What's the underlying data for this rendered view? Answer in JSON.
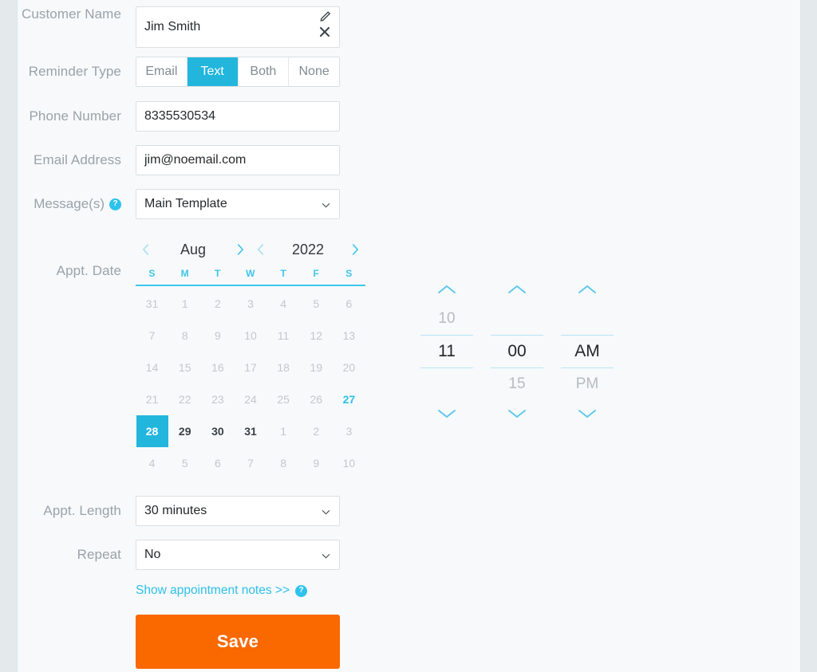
{
  "theme": {
    "accent": "#22b6dd",
    "accent_light": "#2ec0ea",
    "save_orange": "#fa6800",
    "label_gray": "#9aa3ab",
    "page_bg": "#f7f9fa",
    "gutter_bg": "#e4e9ec"
  },
  "form": {
    "customer_name": {
      "label": "Customer Name",
      "value": "Jim Smith",
      "placeholder": "Customer Name",
      "edit_icon": "pencil-icon",
      "clear_icon": "close-icon"
    },
    "reminder_type": {
      "label": "Reminder Type",
      "options": [
        "Email",
        "Text",
        "Both",
        "None"
      ],
      "selected": "Text"
    },
    "phone_number": {
      "label": "Phone Number",
      "value": "8335530534",
      "placeholder": "Phone Number"
    },
    "email_address": {
      "label": "Email Address",
      "value": "jim@noemail.com",
      "placeholder": "Email Address"
    },
    "messages": {
      "label": "Message(s)",
      "help_icon": "help-circle-icon",
      "value": "Main Template",
      "options": [
        "Main Template"
      ]
    },
    "appt_date": {
      "label": "Appt. Date"
    },
    "appt_length": {
      "label": "Appt. Length",
      "value": "30 minutes",
      "options": [
        "30 minutes"
      ]
    },
    "repeat": {
      "label": "Repeat",
      "value": "No",
      "options": [
        "No"
      ]
    },
    "notes_link": {
      "text": "Show appointment notes >>",
      "help_icon": "help-circle-icon"
    },
    "save_button": {
      "label": "Save"
    }
  },
  "calendar": {
    "month": "Aug",
    "year": "2022",
    "prev_month_icon": "chevron-left-icon",
    "next_month_icon": "chevron-right-icon",
    "prev_year_icon": "chevron-left-icon",
    "next_year_icon": "chevron-right-icon",
    "dow": [
      "S",
      "M",
      "T",
      "W",
      "T",
      "F",
      "S"
    ],
    "selected_day": 28,
    "today": 27,
    "weeks": [
      [
        {
          "d": "31",
          "state": "other"
        },
        {
          "d": "1",
          "state": "other"
        },
        {
          "d": "2",
          "state": "other"
        },
        {
          "d": "3",
          "state": "other"
        },
        {
          "d": "4",
          "state": "other"
        },
        {
          "d": "5",
          "state": "other"
        },
        {
          "d": "6",
          "state": "other"
        }
      ],
      [
        {
          "d": "7",
          "state": "other"
        },
        {
          "d": "8",
          "state": "other"
        },
        {
          "d": "9",
          "state": "other"
        },
        {
          "d": "10",
          "state": "other"
        },
        {
          "d": "11",
          "state": "other"
        },
        {
          "d": "12",
          "state": "other"
        },
        {
          "d": "13",
          "state": "other"
        }
      ],
      [
        {
          "d": "14",
          "state": "other"
        },
        {
          "d": "15",
          "state": "other"
        },
        {
          "d": "16",
          "state": "other"
        },
        {
          "d": "17",
          "state": "other"
        },
        {
          "d": "18",
          "state": "other"
        },
        {
          "d": "19",
          "state": "other"
        },
        {
          "d": "20",
          "state": "other"
        }
      ],
      [
        {
          "d": "21",
          "state": "other"
        },
        {
          "d": "22",
          "state": "other"
        },
        {
          "d": "23",
          "state": "other"
        },
        {
          "d": "24",
          "state": "other"
        },
        {
          "d": "25",
          "state": "other"
        },
        {
          "d": "26",
          "state": "other"
        },
        {
          "d": "27",
          "state": "today"
        }
      ],
      [
        {
          "d": "28",
          "state": "sel"
        },
        {
          "d": "29",
          "state": "cur"
        },
        {
          "d": "30",
          "state": "cur"
        },
        {
          "d": "31",
          "state": "cur"
        },
        {
          "d": "1",
          "state": "other"
        },
        {
          "d": "2",
          "state": "other"
        },
        {
          "d": "3",
          "state": "other"
        }
      ],
      [
        {
          "d": "4",
          "state": "other"
        },
        {
          "d": "5",
          "state": "other"
        },
        {
          "d": "6",
          "state": "other"
        },
        {
          "d": "7",
          "state": "other"
        },
        {
          "d": "8",
          "state": "other"
        },
        {
          "d": "9",
          "state": "other"
        },
        {
          "d": "10",
          "state": "other"
        }
      ]
    ]
  },
  "time_picker": {
    "hour": {
      "above": "10",
      "value": "11",
      "below": ""
    },
    "minute": {
      "above": "",
      "value": "00",
      "below": "15"
    },
    "meridiem": {
      "above": "",
      "value": "AM",
      "below": "PM"
    },
    "up_icon": "chevron-up-icon",
    "down_icon": "chevron-down-icon"
  }
}
